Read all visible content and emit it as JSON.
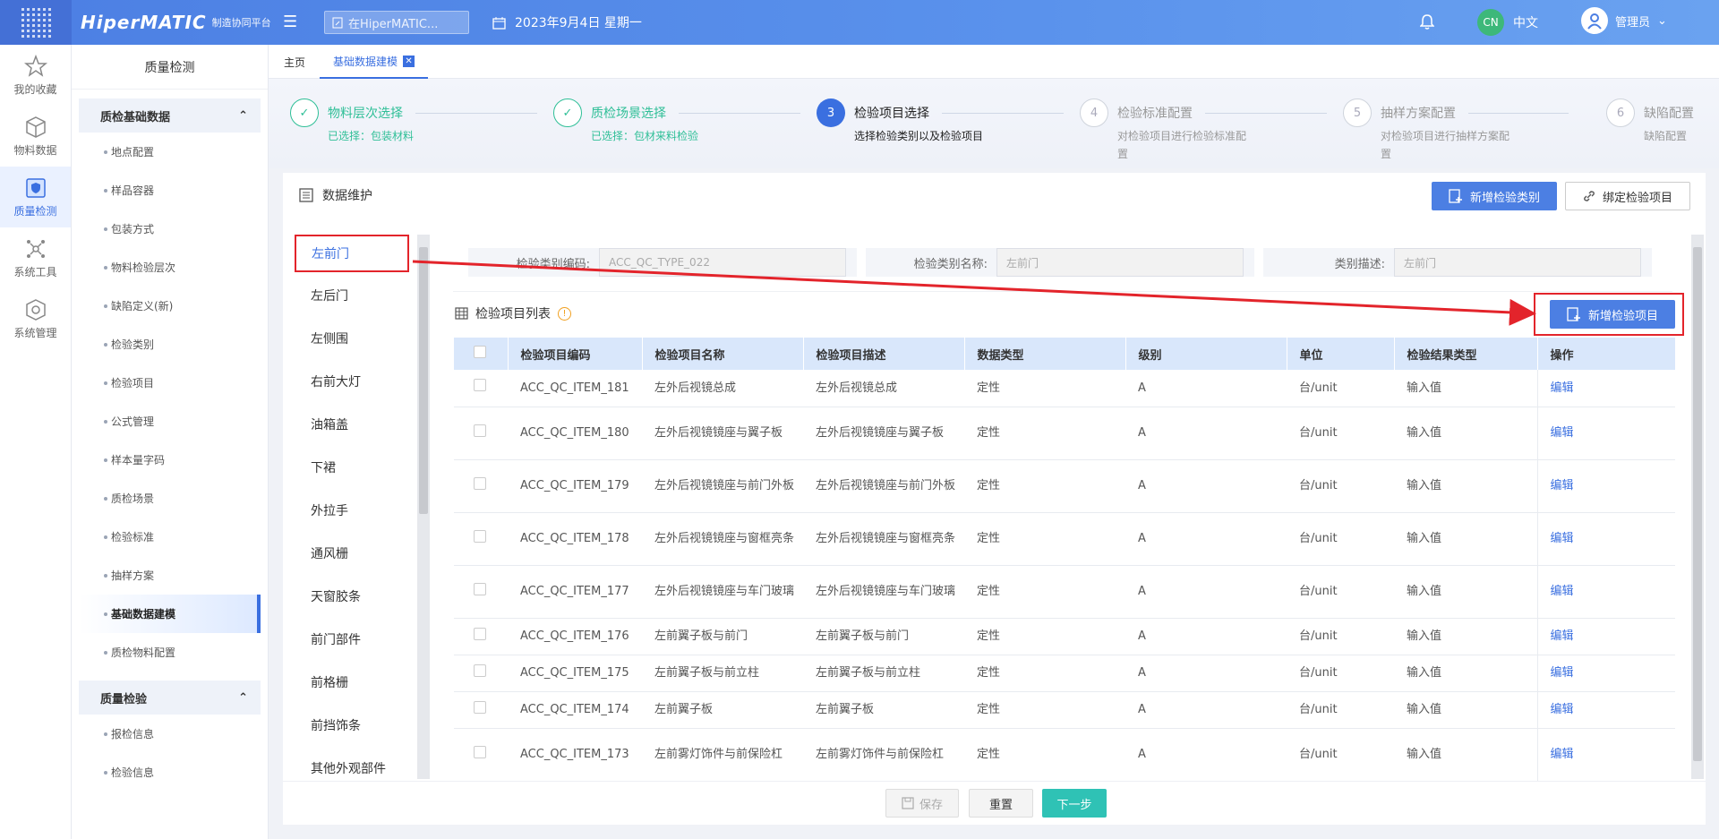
{
  "topbar": {
    "logo": "HiperMATIC",
    "logo_sub": "制造协同平台",
    "search_placeholder": "在HiperMATIC...",
    "date": "2023年9月4日 星期一",
    "lang_badge": "CN",
    "lang_label": "中文",
    "user": "管理员"
  },
  "iconrail": [
    {
      "label": "我的收藏",
      "icon": "star-icon"
    },
    {
      "label": "物料数据",
      "icon": "cube-icon"
    },
    {
      "label": "质量检测",
      "icon": "shield-doc-icon"
    },
    {
      "label": "系统工具",
      "icon": "network-icon"
    },
    {
      "label": "系统管理",
      "icon": "settings-cube-icon"
    }
  ],
  "menu": {
    "title": "质量检测",
    "group1": "质检基础数据",
    "group1_items": [
      "地点配置",
      "样品容器",
      "包装方式",
      "物料检验层次",
      "缺陷定义(新)",
      "检验类别",
      "检验项目",
      "公式管理",
      "样本量字码",
      "质检场景",
      "检验标准",
      "抽样方案",
      "基础数据建模",
      "质检物料配置"
    ],
    "group2": "质量检验",
    "group2_items": [
      "报检信息",
      "检验信息"
    ]
  },
  "tabs": {
    "home": "主页",
    "current": "基础数据建模"
  },
  "steps": [
    {
      "num": "✓",
      "title": "物料层次选择",
      "desc": "已选择：包装材料"
    },
    {
      "num": "✓",
      "title": "质检场景选择",
      "desc": "已选择：包材来料检验"
    },
    {
      "num": "3",
      "title": "检验项目选择",
      "desc": "选择检验类别以及检验项目"
    },
    {
      "num": "4",
      "title": "检验标准配置",
      "desc": "对检验项目进行检验标准配置"
    },
    {
      "num": "5",
      "title": "抽样方案配置",
      "desc": "对检验项目进行抽样方案配置"
    },
    {
      "num": "6",
      "title": "缺陷配置",
      "desc": "缺陷配置"
    }
  ],
  "card": {
    "title": "数据维护",
    "btn_add_category": "新增检验类别",
    "btn_bind_item": "绑定检验项目"
  },
  "categories": [
    "左前门",
    "左后门",
    "左侧围",
    "右前大灯",
    "油箱盖",
    "下裙",
    "外拉手",
    "通风栅",
    "天窗胶条",
    "前门部件",
    "前格栅",
    "前挡饰条",
    "其他外观部件"
  ],
  "filter": {
    "code_label": "检验类别编码:",
    "code_value": "ACC_QC_TYPE_022",
    "name_label": "检验类别名称:",
    "name_value": "左前门",
    "desc_label": "类别描述:",
    "desc_value": "左前门"
  },
  "list": {
    "title": "检验项目列表",
    "btn_add_item": "新增检验项目",
    "columns": [
      "检验项目编码",
      "检验项目名称",
      "检验项目描述",
      "数据类型",
      "级别",
      "单位",
      "检验结果类型",
      "操作"
    ],
    "rows": [
      [
        "ACC_QC_ITEM_181",
        "左外后视镜总成",
        "左外后视镜总成",
        "定性",
        "A",
        "台/unit",
        "输入值",
        "编辑"
      ],
      [
        "ACC_QC_ITEM_180",
        "左外后视镜镜座与翼子板",
        "左外后视镜镜座与翼子板",
        "定性",
        "A",
        "台/unit",
        "输入值",
        "编辑"
      ],
      [
        "ACC_QC_ITEM_179",
        "左外后视镜镜座与前门外板",
        "左外后视镜镜座与前门外板",
        "定性",
        "A",
        "台/unit",
        "输入值",
        "编辑"
      ],
      [
        "ACC_QC_ITEM_178",
        "左外后视镜镜座与窗框亮条",
        "左外后视镜镜座与窗框亮条",
        "定性",
        "A",
        "台/unit",
        "输入值",
        "编辑"
      ],
      [
        "ACC_QC_ITEM_177",
        "左外后视镜镜座与车门玻璃",
        "左外后视镜镜座与车门玻璃",
        "定性",
        "A",
        "台/unit",
        "输入值",
        "编辑"
      ],
      [
        "ACC_QC_ITEM_176",
        "左前翼子板与前门",
        "左前翼子板与前门",
        "定性",
        "A",
        "台/unit",
        "输入值",
        "编辑"
      ],
      [
        "ACC_QC_ITEM_175",
        "左前翼子板与前立柱",
        "左前翼子板与前立柱",
        "定性",
        "A",
        "台/unit",
        "输入值",
        "编辑"
      ],
      [
        "ACC_QC_ITEM_174",
        "左前翼子板",
        "左前翼子板",
        "定性",
        "A",
        "台/unit",
        "输入值",
        "编辑"
      ],
      [
        "ACC_QC_ITEM_173",
        "左前雾灯饰件与前保险杠",
        "左前雾灯饰件与前保险杠",
        "定性",
        "A",
        "台/unit",
        "输入值",
        "编辑"
      ]
    ]
  },
  "footer": {
    "save": "保存",
    "reset": "重置",
    "next": "下一步"
  },
  "colors": {
    "primary": "#4c7fe3",
    "success": "#2fbf97",
    "annotation": "#e3242b",
    "teal": "#2fc2b5"
  }
}
